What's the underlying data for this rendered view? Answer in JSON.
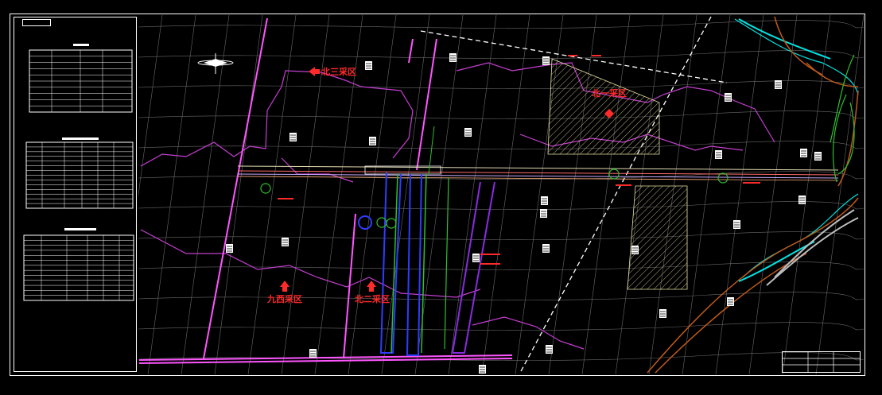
{
  "map": {
    "mining_areas": [
      {
        "id": "north-three",
        "label": "北三采区"
      },
      {
        "id": "north-one",
        "label": "北一采区"
      },
      {
        "id": "nine-west",
        "label": "九西采区"
      },
      {
        "id": "north-two",
        "label": "北二采区"
      }
    ],
    "colors": {
      "background": "#000000",
      "area_label": "#ff2a2a",
      "boundary": "#c43fd0",
      "railway": "#ff66ff",
      "river": "#00e5e5",
      "road": "#c05a1a",
      "grid": "#9a9a9a",
      "shaft_blue": "#2f3cff",
      "shaft_green": "#2fbf2f",
      "hatched_zone": "#e8e0a0"
    },
    "icons": [
      "north-arrow-icon",
      "area-arrow-icon",
      "coordinate-marker-icon"
    ]
  }
}
